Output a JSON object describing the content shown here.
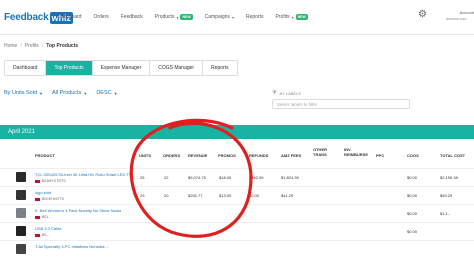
{
  "brand": {
    "name": "Feedback",
    "badge": "whiz",
    "color": "#1a73b8"
  },
  "nav": {
    "items": [
      {
        "label": "Dashboard"
      },
      {
        "label": "Orders"
      },
      {
        "label": "Feedback"
      },
      {
        "label": "Products",
        "badge": "NEW"
      },
      {
        "label": "Campaigns"
      },
      {
        "label": "Reports"
      },
      {
        "label": "Profits",
        "badge": "NEW"
      }
    ],
    "account_name": "Account",
    "account_sub": "Amazon.com"
  },
  "breadcrumb": [
    "Home",
    "Profits",
    "Top Products"
  ],
  "tabs": [
    {
      "label": "Dashboard",
      "active": false
    },
    {
      "label": "Top Products",
      "active": true
    },
    {
      "label": "Expense Manager",
      "active": false
    },
    {
      "label": "COGS Manager",
      "active": false
    },
    {
      "label": "Reports",
      "active": false
    }
  ],
  "filters": {
    "sort_by": "By Units Sold",
    "products": "All Products",
    "order": "DESC",
    "labels_heading": "BY LABELS",
    "labels_placeholder": "Select labels to filter"
  },
  "table": {
    "month": "April 2021",
    "accent": "#19b2a3",
    "columns": {
      "product": "PRODUCT",
      "units": "UNITS",
      "orders": "ORDERS",
      "revenue": "REVENUE",
      "promos": "PROMOS",
      "refunds": "REFUNDS",
      "amz_fees": "AMZ FEES",
      "other_trans": "OTHER\nTRANS",
      "inv_reimburse": "INV.\nREIMBURSE",
      "ppc": "PPC",
      "cogs": "COGS",
      "total_cost": "TOTAL COST"
    },
    "rows": [
      {
        "name": "TCL 55S425 55-Inch 4K Ultra HD Roku Smart LED TV...",
        "sku": "B01MYGTGTS",
        "units": "25",
        "orders": "22",
        "revenue": "$9,074.75",
        "promos": "$18.00",
        "refunds": "$362.99",
        "amz_fees": "$1,824.39",
        "other_trans": "",
        "inv_reimburse": "",
        "ppc": "",
        "cogs": "$0.00",
        "total_cost": "$2,195.38"
      },
      {
        "name": "logo shirt",
        "sku": "B0CEH4977S",
        "units": "29",
        "orders": "20",
        "revenue": "$252.77",
        "promos": "$13.00",
        "refunds": "$0.00",
        "amz_fees": "$41.29",
        "other_trans": "",
        "inv_reimburse": "",
        "ppc": "",
        "cogs": "$0.00",
        "total_cost": "$59.29"
      },
      {
        "name": "K. Bell Women's 4 Pack Novelty No Show Socks",
        "sku": "B01...",
        "units": "",
        "orders": "",
        "revenue": "",
        "promos": "",
        "refunds": "",
        "amz_fees": "",
        "other_trans": "",
        "inv_reimburse": "",
        "ppc": "",
        "cogs": "$0.00",
        "total_cost": "$1,1..."
      },
      {
        "name": "USB 2.0 Cable",
        "sku": "B0...",
        "units": "",
        "orders": "",
        "revenue": "",
        "promos": "",
        "refunds": "",
        "amz_fees": "",
        "other_trans": "",
        "inv_reimburse": "",
        "ppc": "",
        "cogs": "$0.00",
        "total_cost": ""
      },
      {
        "name": "T-fal Specialty 3-PC Initiatives Nonstick ...",
        "sku": "",
        "units": "",
        "orders": "",
        "revenue": "",
        "promos": "",
        "refunds": "",
        "amz_fees": "",
        "other_trans": "",
        "inv_reimburse": "",
        "ppc": "",
        "cogs": "",
        "total_cost": ""
      }
    ]
  },
  "annotation_color": "#e02020"
}
